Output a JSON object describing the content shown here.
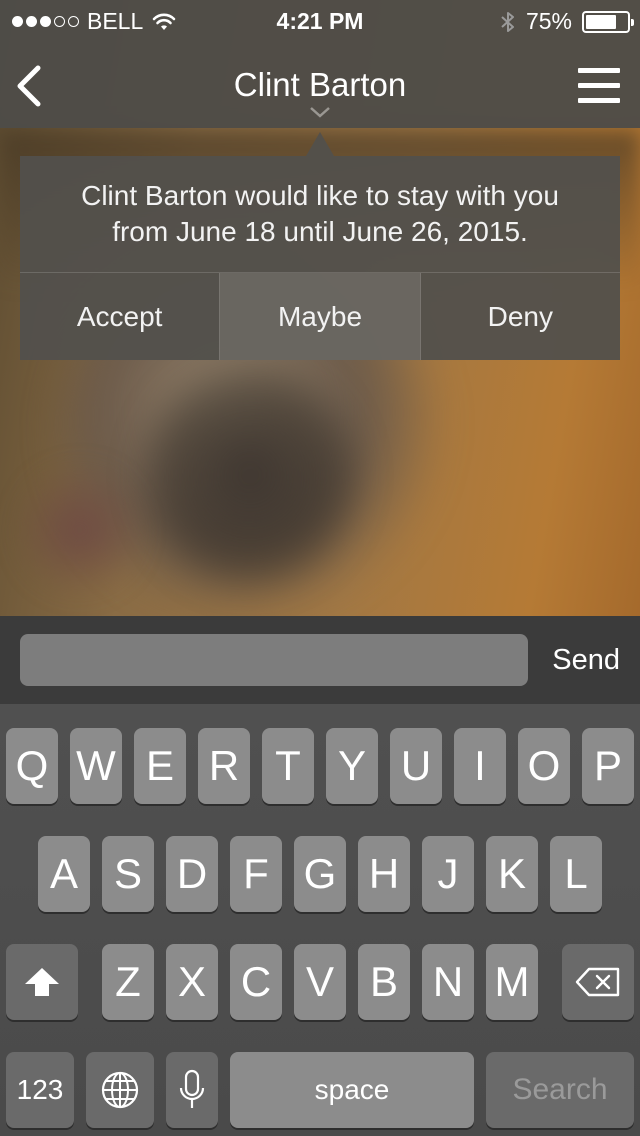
{
  "status_bar": {
    "carrier": "BELL",
    "signal_bars": 3,
    "signal_total": 5,
    "time": "4:21 PM",
    "battery": "75%",
    "battery_level": 0.75
  },
  "nav": {
    "title": "Clint Barton"
  },
  "popover": {
    "message_line1": "Clint Barton would like to stay with you",
    "message_line2": "from June 18 until June 26, 2015.",
    "accept": "Accept",
    "maybe": "Maybe",
    "deny": "Deny"
  },
  "composer": {
    "value": "",
    "send": "Send"
  },
  "keyboard": {
    "row1": [
      "Q",
      "W",
      "E",
      "R",
      "T",
      "Y",
      "U",
      "I",
      "O",
      "P"
    ],
    "row2": [
      "A",
      "S",
      "D",
      "F",
      "G",
      "H",
      "J",
      "K",
      "L"
    ],
    "row3": [
      "Z",
      "X",
      "C",
      "V",
      "B",
      "N",
      "M"
    ],
    "numbers": "123",
    "space": "space",
    "search": "Search"
  },
  "colors": {
    "bar": "#4e4c48",
    "key": "#8c8c8c",
    "key_dark": "#6a6a6a"
  }
}
